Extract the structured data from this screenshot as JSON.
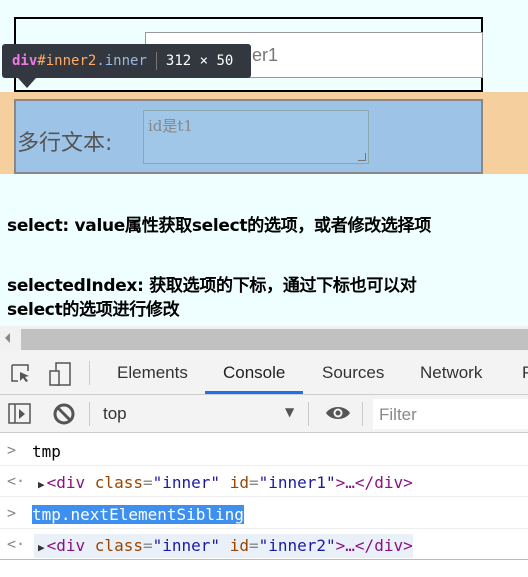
{
  "page": {
    "inner1_input_value": "inner1",
    "textarea_label": "多行文本:",
    "textarea_placeholder": "id是t1",
    "lines": [
      "select: value属性获取select的选项，或者修改选择项",
      "selectedIndex: 获取选项的下标，通过下标也可以对",
      "select的选项进行修改"
    ]
  },
  "tooltip": {
    "tag": "div",
    "id": "#inner2",
    "cls": ".inner",
    "size": "312 × 50"
  },
  "devtools": {
    "tabs": [
      "Elements",
      "Console",
      "Sources",
      "Network",
      "P"
    ],
    "active_tab": "Console",
    "context": "top",
    "filter_placeholder": "Filter",
    "console": [
      {
        "type": "input",
        "text": "tmp"
      },
      {
        "type": "output",
        "tag_open": "<div ",
        "a1": "class",
        "v1": "\"inner\"",
        "a2": "id",
        "v2": "\"inner1\"",
        "tail": ">…</div>"
      },
      {
        "type": "input",
        "text": "tmp.nextElementSibling"
      },
      {
        "type": "output",
        "tag_open": "<div ",
        "a1": "class",
        "v1": "\"inner\"",
        "a2": "id",
        "v2": "\"inner2\"",
        "tail": ">…</div>"
      }
    ]
  },
  "colors": {
    "accent": "#1a73e8",
    "selection": "#3d8ff0",
    "highlight_content": "#9dc3e6",
    "highlight_margin": "#f6cf9f"
  }
}
